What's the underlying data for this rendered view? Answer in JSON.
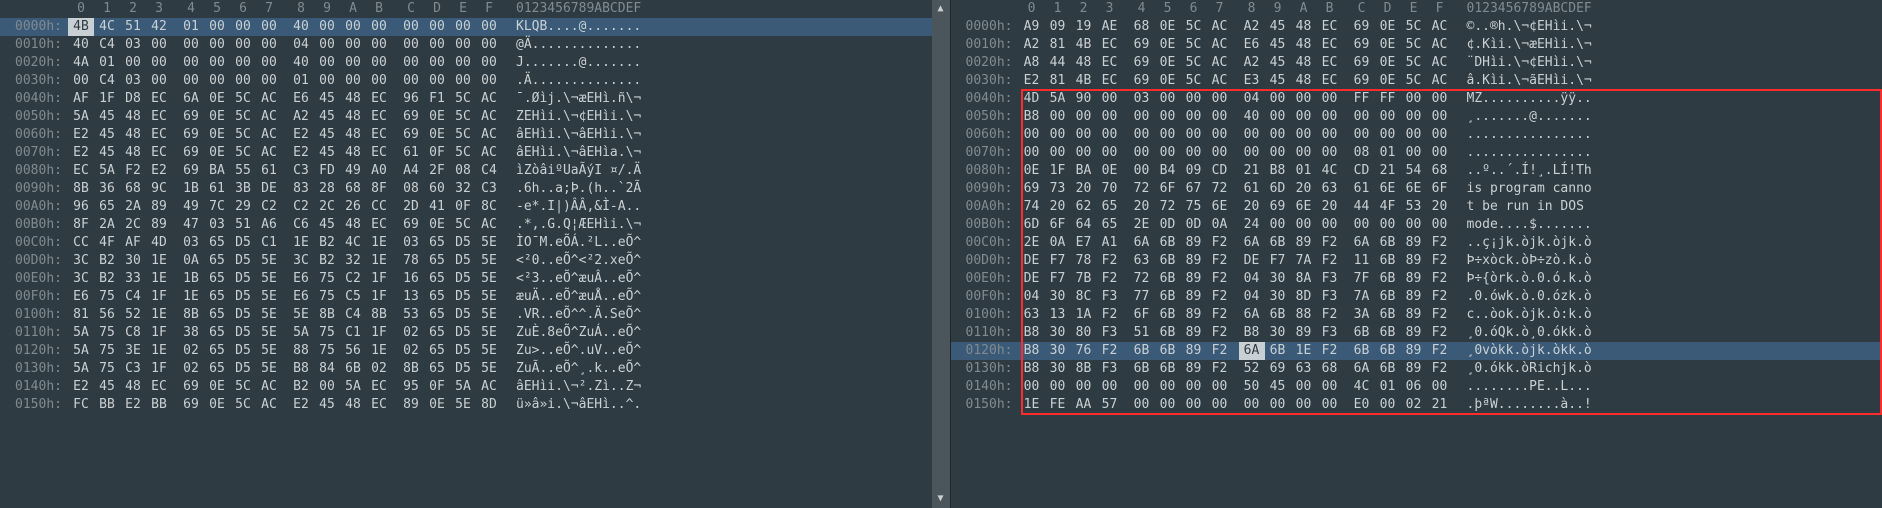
{
  "hex_header_cols": [
    "0",
    "1",
    "2",
    "3",
    "4",
    "5",
    "6",
    "7",
    "8",
    "9",
    "A",
    "B",
    "C",
    "D",
    "E",
    "F"
  ],
  "ascii_header": "0123456789ABCDEF",
  "left": {
    "rows": [
      {
        "off": "0000h:",
        "sel": true,
        "cursor": 0,
        "hex": [
          "4B",
          "4C",
          "51",
          "42",
          "01",
          "00",
          "00",
          "00",
          "40",
          "00",
          "00",
          "00",
          "00",
          "00",
          "00",
          "00"
        ],
        "ascii": "KLQB....@......."
      },
      {
        "off": "0010h:",
        "hex": [
          "40",
          "C4",
          "03",
          "00",
          "00",
          "00",
          "00",
          "00",
          "04",
          "00",
          "00",
          "00",
          "00",
          "00",
          "00",
          "00"
        ],
        "ascii": "@Ä.............."
      },
      {
        "off": "0020h:",
        "hex": [
          "4A",
          "01",
          "00",
          "00",
          "00",
          "00",
          "00",
          "00",
          "40",
          "00",
          "00",
          "00",
          "00",
          "00",
          "00",
          "00"
        ],
        "ascii": "J.......@......."
      },
      {
        "off": "0030h:",
        "hex": [
          "00",
          "C4",
          "03",
          "00",
          "00",
          "00",
          "00",
          "00",
          "01",
          "00",
          "00",
          "00",
          "00",
          "00",
          "00",
          "00"
        ],
        "ascii": ".Ä.............."
      },
      {
        "off": "0040h:",
        "hex": [
          "AF",
          "1F",
          "D8",
          "EC",
          "6A",
          "0E",
          "5C",
          "AC",
          "E6",
          "45",
          "48",
          "EC",
          "96",
          "F1",
          "5C",
          "AC"
        ],
        "ascii": "¯.Øìj.\\¬æEHì.ñ\\¬"
      },
      {
        "off": "0050h:",
        "hex": [
          "5A",
          "45",
          "48",
          "EC",
          "69",
          "0E",
          "5C",
          "AC",
          "A2",
          "45",
          "48",
          "EC",
          "69",
          "0E",
          "5C",
          "AC"
        ],
        "ascii": "ZEHìi.\\¬¢EHìi.\\¬"
      },
      {
        "off": "0060h:",
        "hex": [
          "E2",
          "45",
          "48",
          "EC",
          "69",
          "0E",
          "5C",
          "AC",
          "E2",
          "45",
          "48",
          "EC",
          "69",
          "0E",
          "5C",
          "AC"
        ],
        "ascii": "âEHìi.\\¬âEHìi.\\¬"
      },
      {
        "off": "0070h:",
        "hex": [
          "E2",
          "45",
          "48",
          "EC",
          "69",
          "0E",
          "5C",
          "AC",
          "E2",
          "45",
          "48",
          "EC",
          "61",
          "0F",
          "5C",
          "AC"
        ],
        "ascii": "âEHìi.\\¬âEHìa.\\¬"
      },
      {
        "off": "0080h:",
        "hex": [
          "EC",
          "5A",
          "F2",
          "E2",
          "69",
          "BA",
          "55",
          "61",
          "C3",
          "FD",
          "49",
          "A0",
          "A4",
          "2F",
          "08",
          "C4"
        ],
        "ascii": "ìZòâiºUaÃýI ¤/.Ä"
      },
      {
        "off": "0090h:",
        "hex": [
          "8B",
          "36",
          "68",
          "9C",
          "1B",
          "61",
          "3B",
          "DE",
          "83",
          "28",
          "68",
          "8F",
          "08",
          "60",
          "32",
          "C3"
        ],
        "ascii": ".6h..a;Þ.(h..`2Ã"
      },
      {
        "off": "00A0h:",
        "hex": [
          "96",
          "65",
          "2A",
          "89",
          "49",
          "7C",
          "29",
          "C2",
          "C2",
          "2C",
          "26",
          "CC",
          "2D",
          "41",
          "0F",
          "8C"
        ],
        "ascii": "-e*.I|)ÂÂ,&Ì-A.."
      },
      {
        "off": "00B0h:",
        "hex": [
          "8F",
          "2A",
          "2C",
          "89",
          "47",
          "03",
          "51",
          "A6",
          "C6",
          "45",
          "48",
          "EC",
          "69",
          "0E",
          "5C",
          "AC"
        ],
        "ascii": ".*,.G.Q¦ÆEHìi.\\¬"
      },
      {
        "off": "00C0h:",
        "hex": [
          "CC",
          "4F",
          "AF",
          "4D",
          "03",
          "65",
          "D5",
          "C1",
          "1E",
          "B2",
          "4C",
          "1E",
          "03",
          "65",
          "D5",
          "5E"
        ],
        "ascii": "ÌO¯M.eÕÁ.²L..eÕ^"
      },
      {
        "off": "00D0h:",
        "hex": [
          "3C",
          "B2",
          "30",
          "1E",
          "0A",
          "65",
          "D5",
          "5E",
          "3C",
          "B2",
          "32",
          "1E",
          "78",
          "65",
          "D5",
          "5E"
        ],
        "ascii": "<²0..eÕ^<²2.xeÕ^"
      },
      {
        "off": "00E0h:",
        "hex": [
          "3C",
          "B2",
          "33",
          "1E",
          "1B",
          "65",
          "D5",
          "5E",
          "E6",
          "75",
          "C2",
          "1F",
          "16",
          "65",
          "D5",
          "5E"
        ],
        "ascii": "<²3..eÕ^æuÂ..eÕ^"
      },
      {
        "off": "00F0h:",
        "hex": [
          "E6",
          "75",
          "C4",
          "1F",
          "1E",
          "65",
          "D5",
          "5E",
          "E6",
          "75",
          "C5",
          "1F",
          "13",
          "65",
          "D5",
          "5E"
        ],
        "ascii": "æuÄ..eÕ^æuÅ..eÕ^"
      },
      {
        "off": "0100h:",
        "hex": [
          "81",
          "56",
          "52",
          "1E",
          "8B",
          "65",
          "D5",
          "5E",
          "5E",
          "8B",
          "C4",
          "8B",
          "53",
          "65",
          "D5",
          "5E"
        ],
        "ascii": ".VR..eÕ^^.Ä.SeÕ^"
      },
      {
        "off": "0110h:",
        "hex": [
          "5A",
          "75",
          "C8",
          "1F",
          "38",
          "65",
          "D5",
          "5E",
          "5A",
          "75",
          "C1",
          "1F",
          "02",
          "65",
          "D5",
          "5E"
        ],
        "ascii": "ZuÈ.8eÕ^ZuÁ..eÕ^"
      },
      {
        "off": "0120h:",
        "hex": [
          "5A",
          "75",
          "3E",
          "1E",
          "02",
          "65",
          "D5",
          "5E",
          "88",
          "75",
          "56",
          "1E",
          "02",
          "65",
          "D5",
          "5E"
        ],
        "ascii": "Zu>..eÕ^.uV..eÕ^"
      },
      {
        "off": "0130h:",
        "hex": [
          "5A",
          "75",
          "C3",
          "1F",
          "02",
          "65",
          "D5",
          "5E",
          "B8",
          "84",
          "6B",
          "02",
          "8B",
          "65",
          "D5",
          "5E"
        ],
        "ascii": "ZuÃ..eÕ^¸.k..eÕ^"
      },
      {
        "off": "0140h:",
        "hex": [
          "E2",
          "45",
          "48",
          "EC",
          "69",
          "0E",
          "5C",
          "AC",
          "B2",
          "00",
          "5A",
          "EC",
          "95",
          "0F",
          "5A",
          "AC"
        ],
        "ascii": "âEHìi.\\¬².Zì..Z¬"
      },
      {
        "off": "0150h:",
        "hex": [
          "FC",
          "BB",
          "E2",
          "BB",
          "69",
          "0E",
          "5C",
          "AC",
          "E2",
          "45",
          "48",
          "EC",
          "89",
          "0E",
          "5E",
          "8D"
        ],
        "ascii": "ü»â»i.\\¬âEHì..^."
      }
    ]
  },
  "right": {
    "highlight_box": true,
    "rows": [
      {
        "off": "0000h:",
        "hex": [
          "A9",
          "09",
          "19",
          "AE",
          "68",
          "0E",
          "5C",
          "AC",
          "A2",
          "45",
          "48",
          "EC",
          "69",
          "0E",
          "5C",
          "AC"
        ],
        "ascii": "©..®h.\\¬¢EHìi.\\¬"
      },
      {
        "off": "0010h:",
        "hex": [
          "A2",
          "81",
          "4B",
          "EC",
          "69",
          "0E",
          "5C",
          "AC",
          "E6",
          "45",
          "48",
          "EC",
          "69",
          "0E",
          "5C",
          "AC"
        ],
        "ascii": "¢.Kìi.\\¬æEHìi.\\¬"
      },
      {
        "off": "0020h:",
        "hex": [
          "A8",
          "44",
          "48",
          "EC",
          "69",
          "0E",
          "5C",
          "AC",
          "A2",
          "45",
          "48",
          "EC",
          "69",
          "0E",
          "5C",
          "AC"
        ],
        "ascii": "¨DHìi.\\¬¢EHìi.\\¬"
      },
      {
        "off": "0030h:",
        "hex": [
          "E2",
          "81",
          "4B",
          "EC",
          "69",
          "0E",
          "5C",
          "AC",
          "E3",
          "45",
          "48",
          "EC",
          "69",
          "0E",
          "5C",
          "AC"
        ],
        "ascii": "â.Kìi.\\¬ãEHìi.\\¬"
      },
      {
        "off": "0040h:",
        "hl": true,
        "hex": [
          "4D",
          "5A",
          "90",
          "00",
          "03",
          "00",
          "00",
          "00",
          "04",
          "00",
          "00",
          "00",
          "FF",
          "FF",
          "00",
          "00"
        ],
        "ascii": "MZ..........ÿÿ.."
      },
      {
        "off": "0050h:",
        "hl": true,
        "hex": [
          "B8",
          "00",
          "00",
          "00",
          "00",
          "00",
          "00",
          "00",
          "40",
          "00",
          "00",
          "00",
          "00",
          "00",
          "00",
          "00"
        ],
        "ascii": "¸.......@......."
      },
      {
        "off": "0060h:",
        "hl": true,
        "hex": [
          "00",
          "00",
          "00",
          "00",
          "00",
          "00",
          "00",
          "00",
          "00",
          "00",
          "00",
          "00",
          "00",
          "00",
          "00",
          "00"
        ],
        "ascii": "................"
      },
      {
        "off": "0070h:",
        "hl": true,
        "hex": [
          "00",
          "00",
          "00",
          "00",
          "00",
          "00",
          "00",
          "00",
          "00",
          "00",
          "00",
          "00",
          "08",
          "01",
          "00",
          "00"
        ],
        "ascii": "................"
      },
      {
        "off": "0080h:",
        "hl": true,
        "hex": [
          "0E",
          "1F",
          "BA",
          "0E",
          "00",
          "B4",
          "09",
          "CD",
          "21",
          "B8",
          "01",
          "4C",
          "CD",
          "21",
          "54",
          "68"
        ],
        "ascii": "..º..´.Í!¸.LÍ!Th"
      },
      {
        "off": "0090h:",
        "hl": true,
        "hex": [
          "69",
          "73",
          "20",
          "70",
          "72",
          "6F",
          "67",
          "72",
          "61",
          "6D",
          "20",
          "63",
          "61",
          "6E",
          "6E",
          "6F"
        ],
        "ascii": "is program canno"
      },
      {
        "off": "00A0h:",
        "hl": true,
        "hex": [
          "74",
          "20",
          "62",
          "65",
          "20",
          "72",
          "75",
          "6E",
          "20",
          "69",
          "6E",
          "20",
          "44",
          "4F",
          "53",
          "20"
        ],
        "ascii": "t be run in DOS "
      },
      {
        "off": "00B0h:",
        "hl": true,
        "hex": [
          "6D",
          "6F",
          "64",
          "65",
          "2E",
          "0D",
          "0D",
          "0A",
          "24",
          "00",
          "00",
          "00",
          "00",
          "00",
          "00",
          "00"
        ],
        "ascii": "mode....$......."
      },
      {
        "off": "00C0h:",
        "hl": true,
        "hex": [
          "2E",
          "0A",
          "E7",
          "A1",
          "6A",
          "6B",
          "89",
          "F2",
          "6A",
          "6B",
          "89",
          "F2",
          "6A",
          "6B",
          "89",
          "F2"
        ],
        "ascii": "..ç¡jk.òjk.òjk.ò"
      },
      {
        "off": "00D0h:",
        "hl": true,
        "hex": [
          "DE",
          "F7",
          "78",
          "F2",
          "63",
          "6B",
          "89",
          "F2",
          "DE",
          "F7",
          "7A",
          "F2",
          "11",
          "6B",
          "89",
          "F2"
        ],
        "ascii": "Þ÷xòck.òÞ÷zò.k.ò"
      },
      {
        "off": "00E0h:",
        "hl": true,
        "hex": [
          "DE",
          "F7",
          "7B",
          "F2",
          "72",
          "6B",
          "89",
          "F2",
          "04",
          "30",
          "8A",
          "F3",
          "7F",
          "6B",
          "89",
          "F2"
        ],
        "ascii": "Þ÷{òrk.ò.0.ó.k.ò"
      },
      {
        "off": "00F0h:",
        "hl": true,
        "hex": [
          "04",
          "30",
          "8C",
          "F3",
          "77",
          "6B",
          "89",
          "F2",
          "04",
          "30",
          "8D",
          "F3",
          "7A",
          "6B",
          "89",
          "F2"
        ],
        "ascii": ".0.ówk.ò.0.ózk.ò"
      },
      {
        "off": "0100h:",
        "hl": true,
        "hex": [
          "63",
          "13",
          "1A",
          "F2",
          "6F",
          "6B",
          "89",
          "F2",
          "6A",
          "6B",
          "88",
          "F2",
          "3A",
          "6B",
          "89",
          "F2"
        ],
        "ascii": "c..òok.òjk.ò:k.ò"
      },
      {
        "off": "0110h:",
        "hl": true,
        "hex": [
          "B8",
          "30",
          "80",
          "F3",
          "51",
          "6B",
          "89",
          "F2",
          "B8",
          "30",
          "89",
          "F3",
          "6B",
          "6B",
          "89",
          "F2"
        ],
        "ascii": "¸0.óQk.ò¸0.ókk.ò"
      },
      {
        "off": "0120h:",
        "sel": true,
        "cursor": 8,
        "hl": true,
        "hex": [
          "B8",
          "30",
          "76",
          "F2",
          "6B",
          "6B",
          "89",
          "F2",
          "6A",
          "6B",
          "1E",
          "F2",
          "6B",
          "6B",
          "89",
          "F2"
        ],
        "ascii": "¸0vòkk.òjk.òkk.ò"
      },
      {
        "off": "0130h:",
        "hl": true,
        "hex": [
          "B8",
          "30",
          "8B",
          "F3",
          "6B",
          "6B",
          "89",
          "F2",
          "52",
          "69",
          "63",
          "68",
          "6A",
          "6B",
          "89",
          "F2"
        ],
        "ascii": "¸0.ókk.òRichjk.ò"
      },
      {
        "off": "0140h:",
        "hl": true,
        "hex": [
          "00",
          "00",
          "00",
          "00",
          "00",
          "00",
          "00",
          "00",
          "50",
          "45",
          "00",
          "00",
          "4C",
          "01",
          "06",
          "00"
        ],
        "ascii": "........PE..L..."
      },
      {
        "off": "0150h:",
        "hl": true,
        "hex": [
          "1E",
          "FE",
          "AA",
          "57",
          "00",
          "00",
          "00",
          "00",
          "00",
          "00",
          "00",
          "00",
          "E0",
          "00",
          "02",
          "21"
        ],
        "ascii": ".þªW........à..!"
      }
    ]
  }
}
